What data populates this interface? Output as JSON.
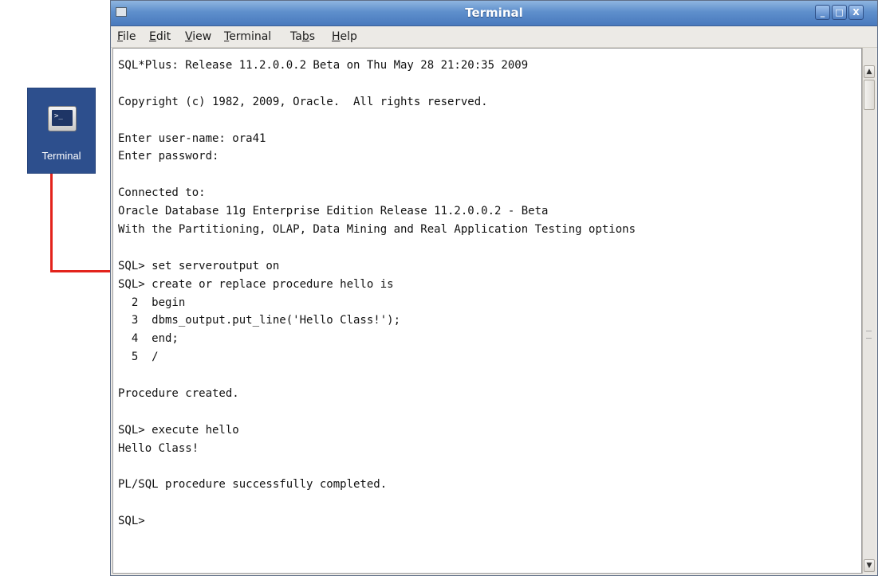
{
  "desktop": {
    "launcher_icon": "terminal-icon",
    "launcher_caption": "Terminal",
    "launcher_glyph": ">_",
    "arrow_color": "#e3231c"
  },
  "window": {
    "title": "Terminal",
    "titlebar_color": "#5e8fcc",
    "controls": {
      "minimize": "_",
      "maximize": "□",
      "close": "X"
    },
    "menu": [
      {
        "label": "File",
        "mnemonic": "F"
      },
      {
        "label": "Edit",
        "mnemonic": "E"
      },
      {
        "label": "View",
        "mnemonic": "V"
      },
      {
        "label": "Terminal",
        "mnemonic": "T"
      },
      {
        "label": "Tabs",
        "mnemonic": "b"
      },
      {
        "label": "Help",
        "mnemonic": "H"
      }
    ]
  },
  "terminal": {
    "lines": [
      "SQL*Plus: Release 11.2.0.0.2 Beta on Thu May 28 21:20:35 2009",
      "",
      "Copyright (c) 1982, 2009, Oracle.  All rights reserved.",
      "",
      "Enter user-name: ora41",
      "Enter password:",
      "",
      "Connected to:",
      "Oracle Database 11g Enterprise Edition Release 11.2.0.0.2 - Beta",
      "With the Partitioning, OLAP, Data Mining and Real Application Testing options",
      "",
      "SQL> set serveroutput on",
      "SQL> create or replace procedure hello is",
      "  2  begin",
      "  3  dbms_output.put_line('Hello Class!');",
      "  4  end;",
      "  5  /",
      "",
      "Procedure created.",
      "",
      "SQL> execute hello",
      "Hello Class!",
      "",
      "PL/SQL procedure successfully completed.",
      "",
      "SQL>"
    ]
  }
}
